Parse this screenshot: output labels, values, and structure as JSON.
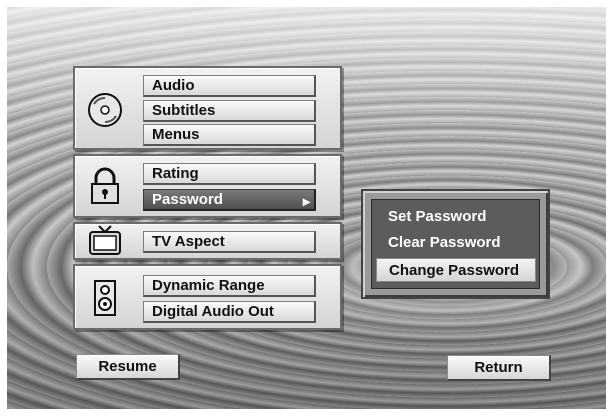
{
  "menu": {
    "groups": [
      {
        "icon": "disc-icon",
        "items": [
          "Audio",
          "Subtitles",
          "Menus"
        ]
      },
      {
        "icon": "padlock-icon",
        "items": [
          "Rating",
          "Password"
        ]
      },
      {
        "icon": "tv-icon",
        "items": [
          "TV Aspect"
        ]
      },
      {
        "icon": "speaker-icon",
        "items": [
          "Dynamic Range",
          "Digital Audio Out"
        ]
      }
    ],
    "selected": "Password"
  },
  "submenu": {
    "items": [
      "Set Password",
      "Clear Password",
      "Change Password"
    ],
    "active": "Change Password"
  },
  "footer": {
    "resume_label": "Resume",
    "return_label": "Return"
  }
}
